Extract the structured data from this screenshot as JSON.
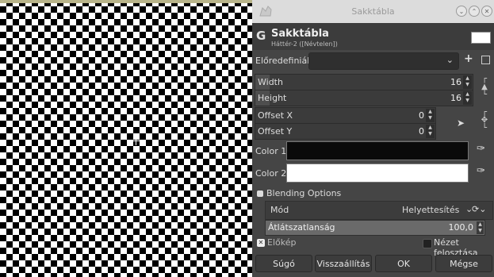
{
  "titlebar": {
    "title": "Sakktábla"
  },
  "header": {
    "icon": "G",
    "title": "Sakktábla",
    "subtitle": "Háttér-2 ([Névtelen])"
  },
  "presets": {
    "label": "Előredefiniált:",
    "value": ""
  },
  "fields": {
    "width": {
      "label": "Width",
      "value": "16"
    },
    "height": {
      "label": "Height",
      "value": "16"
    },
    "offset_x": {
      "label": "Offset X",
      "value": "0"
    },
    "offset_y": {
      "label": "Offset Y",
      "value": "0"
    }
  },
  "colors": {
    "color1": {
      "label": "Color 1",
      "value": "#0a0a0a"
    },
    "color2": {
      "label": "Color 2",
      "value": "#ffffff"
    }
  },
  "blending": {
    "heading": "Blending Options",
    "mode_label": "Mód",
    "mode_value": "Helyettesítés",
    "opacity_label": "Átlátszatlanság",
    "opacity_value": "100,0"
  },
  "options": {
    "preview_label": "Előkép",
    "preview_checked": true,
    "split_label": "Nézet felosztása",
    "split_checked": false
  },
  "buttons": {
    "help": "Súgó",
    "reset": "Visszaállítás",
    "ok": "OK",
    "cancel": "Mégse"
  }
}
